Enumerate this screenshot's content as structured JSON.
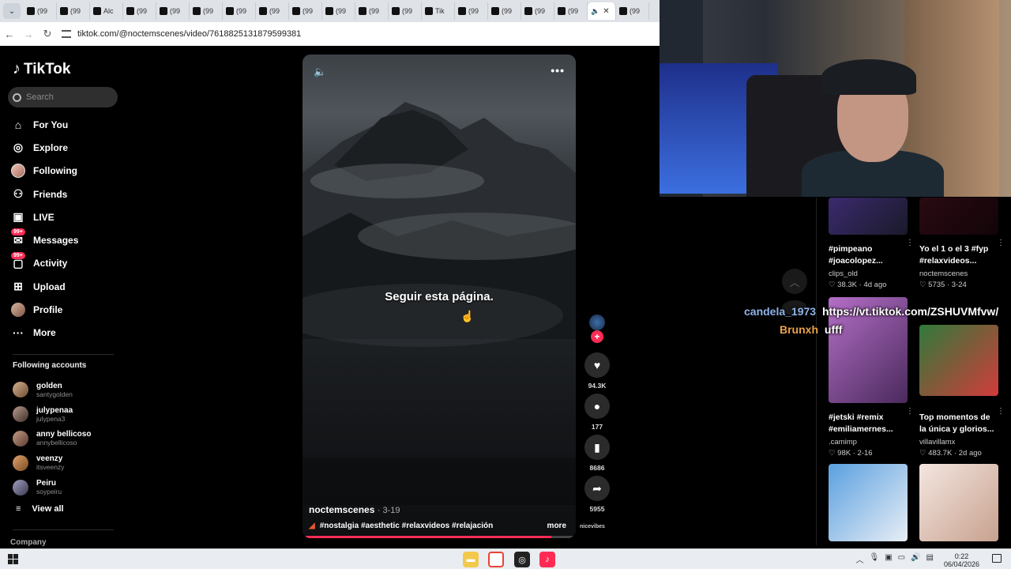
{
  "browser": {
    "tabs": [
      {
        "label": "(99"
      },
      {
        "label": "(99"
      },
      {
        "label": "Alc"
      },
      {
        "label": "(99"
      },
      {
        "label": "(99"
      },
      {
        "label": "(99"
      },
      {
        "label": "(99"
      },
      {
        "label": "(99"
      },
      {
        "label": "(99"
      },
      {
        "label": "(99"
      },
      {
        "label": "(99"
      },
      {
        "label": "(99"
      },
      {
        "label": "Tik"
      },
      {
        "label": "(99"
      },
      {
        "label": "(99"
      },
      {
        "label": "(99"
      },
      {
        "label": "(99"
      },
      {
        "label": "(99"
      }
    ],
    "url": "tiktok.com/@noctemscenes/video/7618825131879599381"
  },
  "sidebar": {
    "logo": "TikTok",
    "search_placeholder": "Search",
    "nav": [
      {
        "label": "For You",
        "icon": "home-icon"
      },
      {
        "label": "Explore",
        "icon": "compass-icon"
      },
      {
        "label": "Following",
        "icon": "following-avatar"
      },
      {
        "label": "Friends",
        "icon": "friends-icon"
      },
      {
        "label": "LIVE",
        "icon": "live-icon"
      },
      {
        "label": "Messages",
        "icon": "messages-icon",
        "badge": "99+"
      },
      {
        "label": "Activity",
        "icon": "activity-icon",
        "badge": "99+"
      },
      {
        "label": "Upload",
        "icon": "upload-icon"
      },
      {
        "label": "Profile",
        "icon": "profile-avatar"
      },
      {
        "label": "More",
        "icon": "more-icon"
      }
    ],
    "following_header": "Following accounts",
    "following": [
      {
        "name": "golden",
        "user": "santygolden"
      },
      {
        "name": "julypenaa",
        "user": "julypena3"
      },
      {
        "name": "anny bellicoso",
        "user": "annybellicoso"
      },
      {
        "name": "veenzy",
        "user": "itsveenzy"
      },
      {
        "name": "Peiru",
        "user": "soypeiru"
      }
    ],
    "view_all": "View all",
    "company": "Company"
  },
  "video": {
    "caption": "Seguir esta página.",
    "author": "noctemscenes",
    "date": "3-19",
    "hashtags": "#nostalgia #aesthetic #relaxvideos #relajación",
    "more_label": "more",
    "progress": 0.92
  },
  "actions": {
    "likes": "94.3K",
    "comments": "177",
    "saves": "8686",
    "shares": "5955",
    "music": "nicevibes"
  },
  "related": [
    {
      "title1": "#pimpeano",
      "title2": "#joacolopez...",
      "user": "clips_old",
      "likes": "38.3K",
      "date": "4d ago"
    },
    {
      "title1": "Yo el 1 o el 3 #fyp",
      "title2": "#relaxvideos...",
      "user": "noctemscenes",
      "likes": "5735",
      "date": "3-24"
    },
    {
      "title1": "#jetski #remix",
      "title2": "#emiliamernes...",
      "user": ".camimp",
      "likes": "98K",
      "date": "2-16"
    },
    {
      "title1": "Top momentos de",
      "title2": "la única y glorios...",
      "user": "villavillamx",
      "likes": "483.7K",
      "date": "2d ago"
    }
  ],
  "chat": [
    {
      "user": "candela_1973",
      "message": "https://vt.tiktok.com/ZSHUVMfvw/",
      "color": "#8fb4e8"
    },
    {
      "user": "Brunxh",
      "message": "ufff",
      "color": "#e8a24a"
    }
  ],
  "taskbar": {
    "time": "0:22",
    "date": "06/04/2026"
  }
}
